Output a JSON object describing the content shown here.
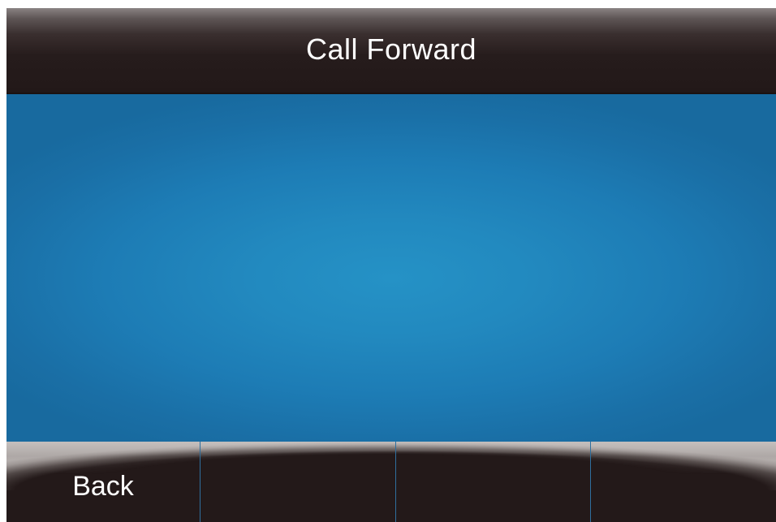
{
  "header": {
    "title": "Call Forward"
  },
  "softkeys": [
    {
      "label": "Back"
    },
    {
      "label": ""
    },
    {
      "label": ""
    },
    {
      "label": ""
    }
  ],
  "colors": {
    "title_bar": "#261c1c",
    "content_background": "#1d7cb5",
    "content_highlight": "#2592c6",
    "softkey_bar": "#231919",
    "softkey_divider": "#2f6f9e",
    "text": "#ffffff"
  }
}
